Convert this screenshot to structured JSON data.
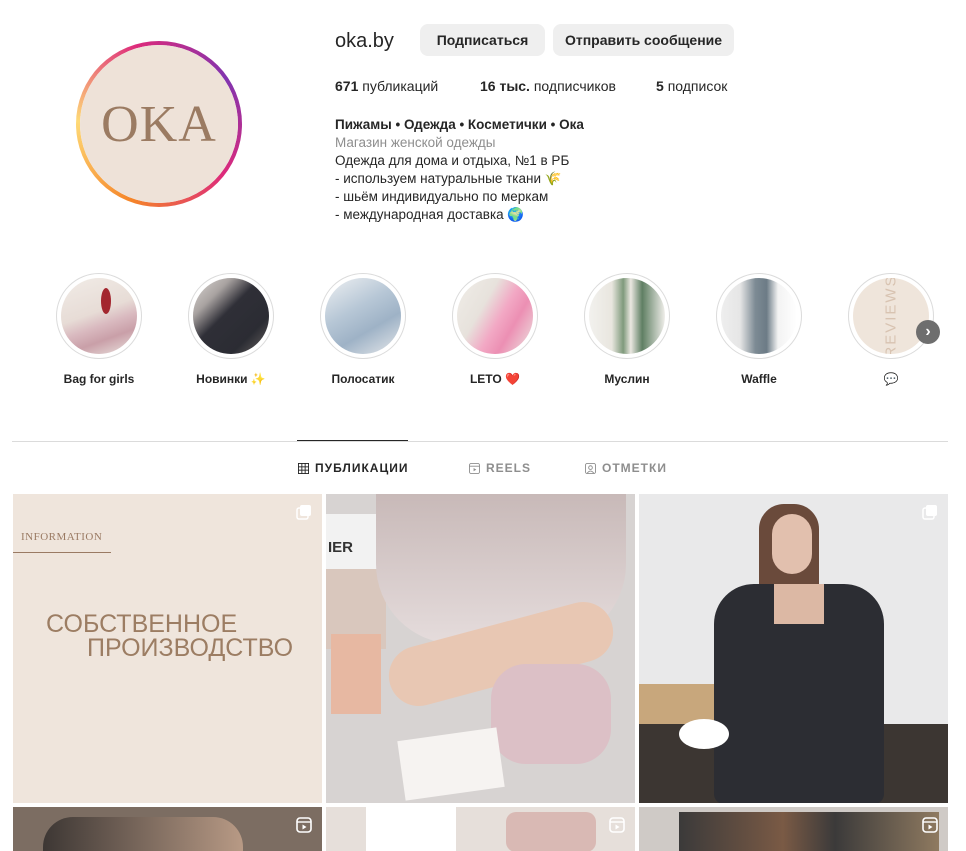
{
  "profile": {
    "username": "oka.by",
    "avatar_text": "OKA",
    "follow_label": "Подписаться",
    "message_label": "Отправить сообщение",
    "posts_count": "671",
    "posts_label": "публикаций",
    "followers_count": "16 тыс.",
    "followers_label": "подписчиков",
    "following_count": "5",
    "following_label": "подписок",
    "bio_name": "Пижамы • Одежда • Косметички • Ока",
    "bio_category": "Магазин женской одежды",
    "bio_lines": [
      "Одежда для дома и отдыха, №1 в РБ",
      "- используем натуральные ткани 🌾",
      "- шьём индивидуально по меркам",
      "- международная доставка 🌍"
    ]
  },
  "highlights": [
    {
      "label": "Bag for girls"
    },
    {
      "label": "Новинки ✨"
    },
    {
      "label": "Полосатик"
    },
    {
      "label": "LETO ❤️"
    },
    {
      "label": "Муслин"
    },
    {
      "label": "Waffle"
    },
    {
      "label": "💬",
      "img_text": "REVIEWS"
    }
  ],
  "tabs": [
    {
      "label": "ПУБЛИКАЦИИ",
      "icon": "grid-icon",
      "active": true
    },
    {
      "label": "REELS",
      "icon": "reels-icon",
      "active": false
    },
    {
      "label": "ОТМЕТКИ",
      "icon": "tagged-icon",
      "active": false
    }
  ],
  "posts": {
    "p1_label": "INFORMATION",
    "p1_line1": "СОБСТВЕННОЕ",
    "p1_line2": "ПРОИЗВОДСТВО",
    "p2_brand": "IER"
  },
  "colors": {
    "accent_bg": "#efe5dc",
    "text_brown": "#9c7d63",
    "button_bg": "#efefef"
  }
}
